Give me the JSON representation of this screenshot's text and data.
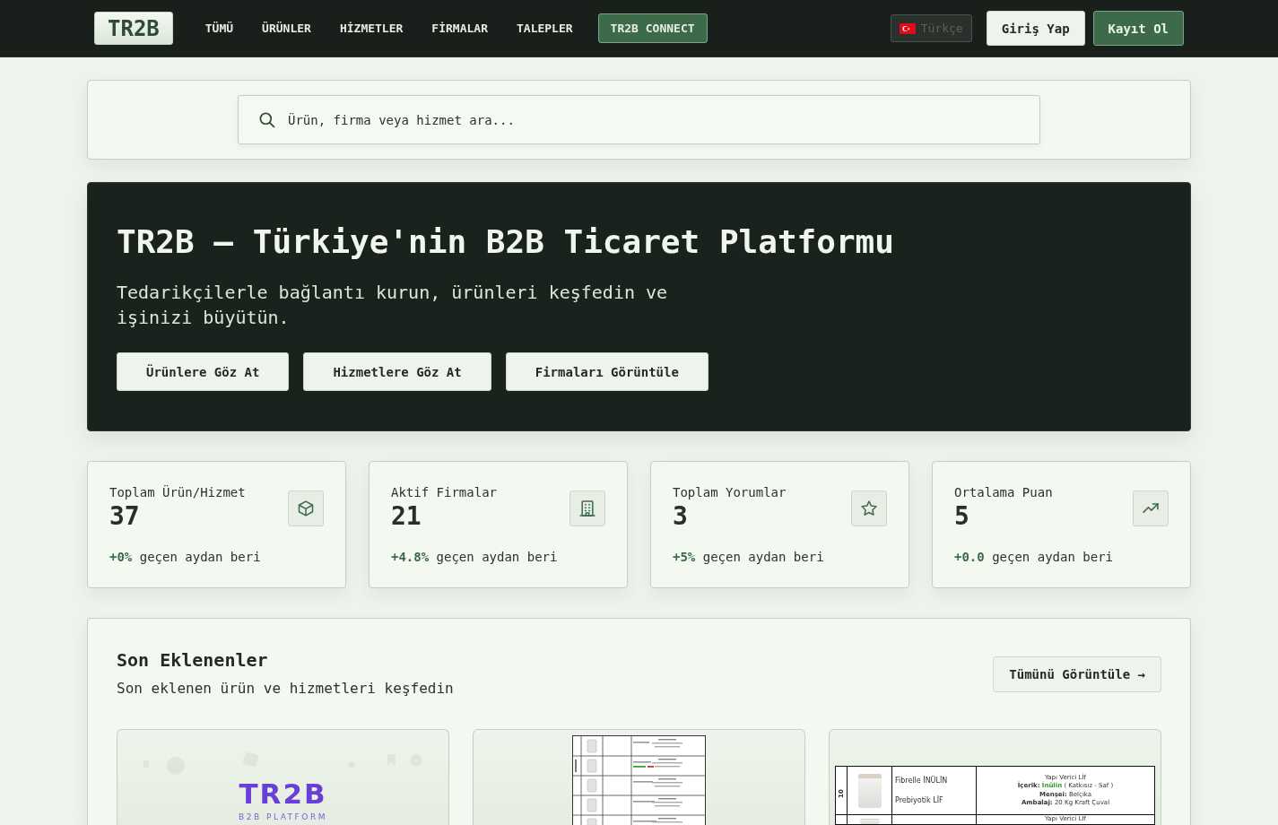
{
  "nav": {
    "logo": "TR2B",
    "links": [
      {
        "label": "TÜMÜ",
        "kind": "link"
      },
      {
        "label": "ÜRÜNLER",
        "kind": "link"
      },
      {
        "label": "HİZMETLER",
        "kind": "link"
      },
      {
        "label": "FİRMALAR",
        "kind": "link"
      },
      {
        "label": "TALEPLER",
        "kind": "link"
      },
      {
        "label": "TR2B CONNECT",
        "kind": "button"
      }
    ],
    "language": {
      "label": "Türkçe",
      "disabled": true
    },
    "buttons": [
      {
        "label": "Giriş Yap",
        "kind": "secondary"
      },
      {
        "label": "Kayıt Ol",
        "kind": "primary"
      }
    ]
  },
  "search": {
    "placeholder": "Ürün, firma veya hizmet ara..."
  },
  "hero": {
    "title": "TR2B – Türkiye'nin B2B Ticaret Platformu",
    "subtitle": "Tedarikçilerle bağlantı kurun, ürünleri keşfedin ve işinizi büyütün.",
    "buttons": [
      "Ürünlere Göz At",
      "Hizmetlere Göz At",
      "Firmaları Görüntüle"
    ]
  },
  "stats": [
    {
      "label": "Toplam Ürün/Hizmet",
      "value": "37",
      "change": "+0%",
      "note": "geçen aydan beri"
    },
    {
      "label": "Aktif Firmalar",
      "value": "21",
      "change": "+4.8%",
      "note": "geçen aydan beri"
    },
    {
      "label": "Toplam Yorumlar",
      "value": "3",
      "change": "+5%",
      "note": "geçen aydan beri"
    },
    {
      "label": "Ortalama Puan",
      "value": "5",
      "change": "+0.0",
      "note": "geçen aydan beri"
    }
  ],
  "recent": {
    "title": "Son Eklenenler",
    "subtitle": "Son eklenen ürün ve hizmetleri keşfedin",
    "button": "Tümünü Görüntüle →",
    "items": [
      {
        "kind": "logo",
        "logo": "TR2B",
        "tagline": "B2B PLATFORM"
      },
      {
        "kind": "document"
      },
      {
        "kind": "table",
        "rows": [
          {
            "number": "10",
            "name": "Fibrelle İNÜLİN",
            "type": "Prebiyotik LİF",
            "details": [
              "Yapı Verici Lİf",
              "**İçerik:** **İnülin** ( Katkısız - Saf )",
              "**Menşei:** Belçika",
              "**Ambalaj:** 20 Kg Kraft Çuval"
            ]
          },
          {
            "details": [
              "Yapı Verici Lİf"
            ]
          }
        ]
      }
    ]
  }
}
